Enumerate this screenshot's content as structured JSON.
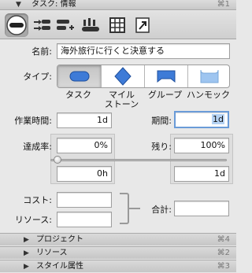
{
  "header": {
    "title": "タスク: 情報",
    "shortcut": "⌘1",
    "collapse_icon": "disclosure-open-triangle"
  },
  "toolbar": {
    "items": [
      {
        "name": "task-info-tab",
        "icon": "task-pill-icon",
        "active": true
      },
      {
        "name": "dependencies-tab",
        "icon": "task-dependency-icon"
      },
      {
        "name": "resource-assignment-tab",
        "icon": "resource-assign-icon"
      },
      {
        "name": "resource-people-tab",
        "icon": "people-icon"
      },
      {
        "name": "table-view-tab",
        "icon": "table-icon"
      },
      {
        "name": "export-link-tab",
        "icon": "arrow-out-icon"
      }
    ]
  },
  "form": {
    "name_label": "名前:",
    "name_value": "海外旅行に行くと決意する",
    "type_label": "タイプ:",
    "types": [
      {
        "label": "タスク",
        "icon": "task-pill-icon",
        "selected": true
      },
      {
        "label": "マイル\nストーン",
        "icon": "milestone-diamond-icon"
      },
      {
        "label": "グループ",
        "icon": "group-bracket-icon"
      },
      {
        "label": "ハンモック",
        "icon": "hammock-icon"
      }
    ],
    "work_label": "作業時間:",
    "work_value": "1d",
    "duration_label": "期間:",
    "duration_value": "1d",
    "complete_label": "達成率:",
    "complete_value": "0%",
    "remaining_label": "残り:",
    "remaining_value": "100%",
    "elapsed_value": "0h",
    "remaining_time_value": "1d",
    "progress_fraction": 0,
    "cost_label": "コスト:",
    "cost_value": "",
    "resources_label": "リソース:",
    "resources_value": "",
    "total_label": "合計:",
    "total_value": ""
  },
  "sections": [
    {
      "title": "プロジェクト",
      "shortcut": "⌘4"
    },
    {
      "title": "リソース",
      "shortcut": "⌘2"
    },
    {
      "title": "スタイル属性",
      "shortcut": "⌘3"
    }
  ]
}
